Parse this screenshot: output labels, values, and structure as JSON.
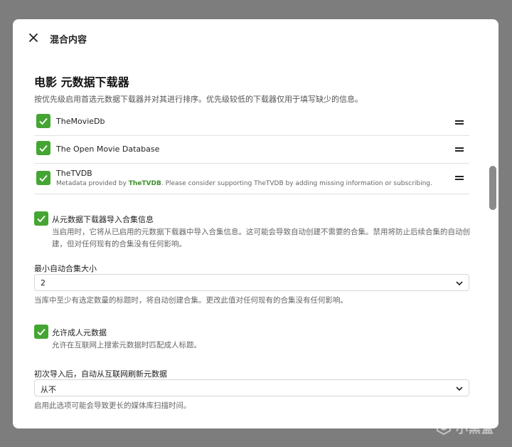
{
  "dialog": {
    "title": "混合内容"
  },
  "section": {
    "title": "电影 元数据下载器",
    "description": "按优先级启用首选元数据下载器并对其进行排序。优先级较低的下载器仅用于填写缺少的信息。"
  },
  "fetchers": [
    {
      "name": "TheMovieDb",
      "checked": true
    },
    {
      "name": "The Open Movie Database",
      "checked": true
    },
    {
      "name": "TheTVDB",
      "checked": true,
      "note_prefix": "Metadata provided by ",
      "note_link": "TheTVDB",
      "note_suffix": ". Please consider supporting TheTVDB by adding missing information or subscribing."
    }
  ],
  "import_collections": {
    "label": "从元数据下载器导入合集信息",
    "checked": true,
    "description": "当启用时，它将从已启用的元数据下载器中导入合集信息。这可能会导致自动创建不需要的合集。禁用将防止后续合集的自动创建，但对任何现有的合集没有任何影响。"
  },
  "min_collection_size": {
    "label": "最小自动合集大小",
    "value": "2",
    "help": "当库中至少有选定数量的标题时，将自动创建合集。更改此值对任何现有的合集没有任何影响。"
  },
  "adult_metadata": {
    "label": "允许成人元数据",
    "checked": true,
    "description": "允许在互联网上搜索元数据时匹配成人标题。"
  },
  "refresh_after_import": {
    "label": "初次导入后，自动从互联网刷新元数据",
    "value": "从不",
    "help": "启用此选项可能会导致更长的媒体库扫描时间。"
  },
  "watermark": {
    "text": "小黑盒"
  },
  "colors": {
    "accent": "#45a533",
    "link": "#3c8f2b"
  }
}
